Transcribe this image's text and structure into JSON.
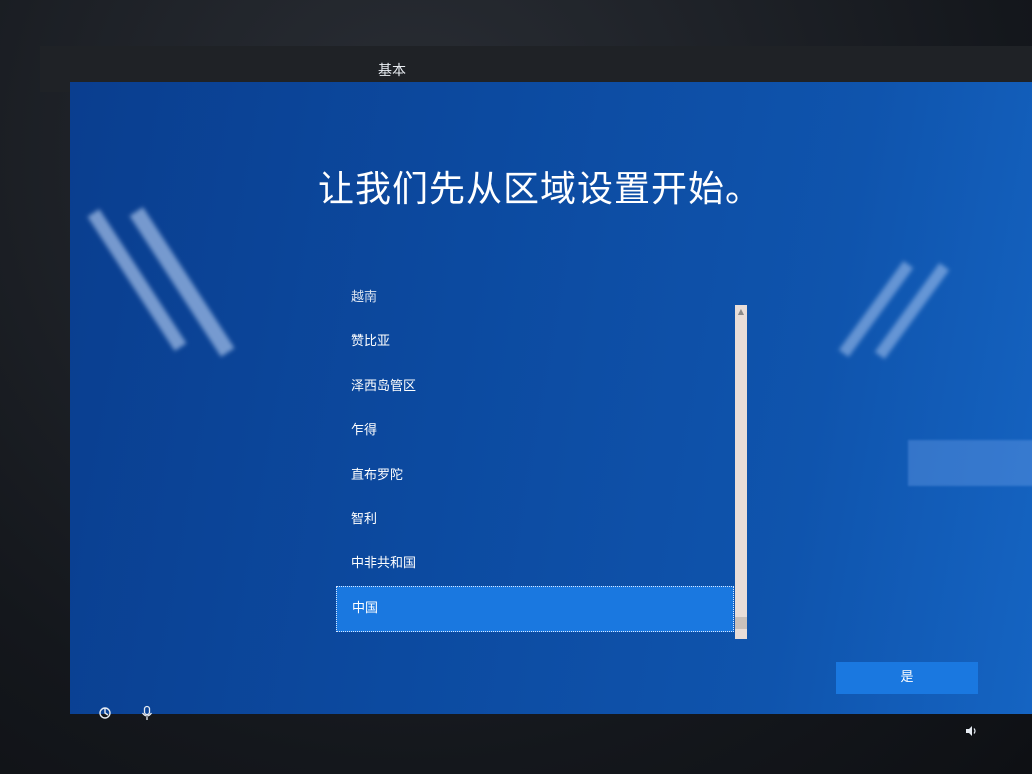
{
  "header": {
    "tab_label": "基本"
  },
  "page": {
    "title": "让我们先从区域设置开始。"
  },
  "region_list": {
    "items": [
      "越南",
      "赞比亚",
      "泽西岛管区",
      "乍得",
      "直布罗陀",
      "智利",
      "中非共和国",
      "中国"
    ],
    "selected": "中国"
  },
  "footer": {
    "yes_label": "是"
  },
  "icons": {
    "accessibility": "accessibility-icon",
    "microphone": "microphone-icon",
    "volume": "volume-icon"
  },
  "colors": {
    "background_blue": "#0c4aa0",
    "accent_blue": "#1a78e0",
    "text": "#ffffff"
  }
}
